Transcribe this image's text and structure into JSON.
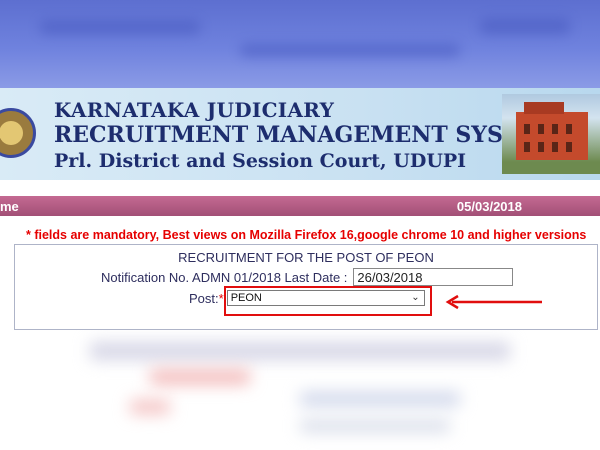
{
  "banner": {
    "line1": "KARNATAKA JUDICIARY",
    "line2": "RECRUITMENT MANAGEMENT SYSTEM",
    "line3": "Prl. District and Session Court, UDUPI"
  },
  "strip": {
    "home_label": "me",
    "date": "05/03/2018"
  },
  "notice": "* fields are mandatory, Best views on Mozilla Firefox 16,google chrome 10 and higher versions",
  "form": {
    "heading": "RECRUITMENT FOR THE POST OF PEON",
    "notification_label": "Notification No. ADMN 01/2018 Last Date :",
    "last_date_value": "26/03/2018",
    "post_label": "Post:",
    "required_mark": "*",
    "post_selected": "PEON"
  },
  "colors": {
    "banner_text": "#1d2d6e",
    "strip_bg": "#a24f76",
    "notice_red": "#e60000",
    "annotation_red": "#e10e0e"
  },
  "icons": {
    "select_arrow": "chevron-down-icon",
    "annotation_arrow": "arrow-left-icon"
  }
}
